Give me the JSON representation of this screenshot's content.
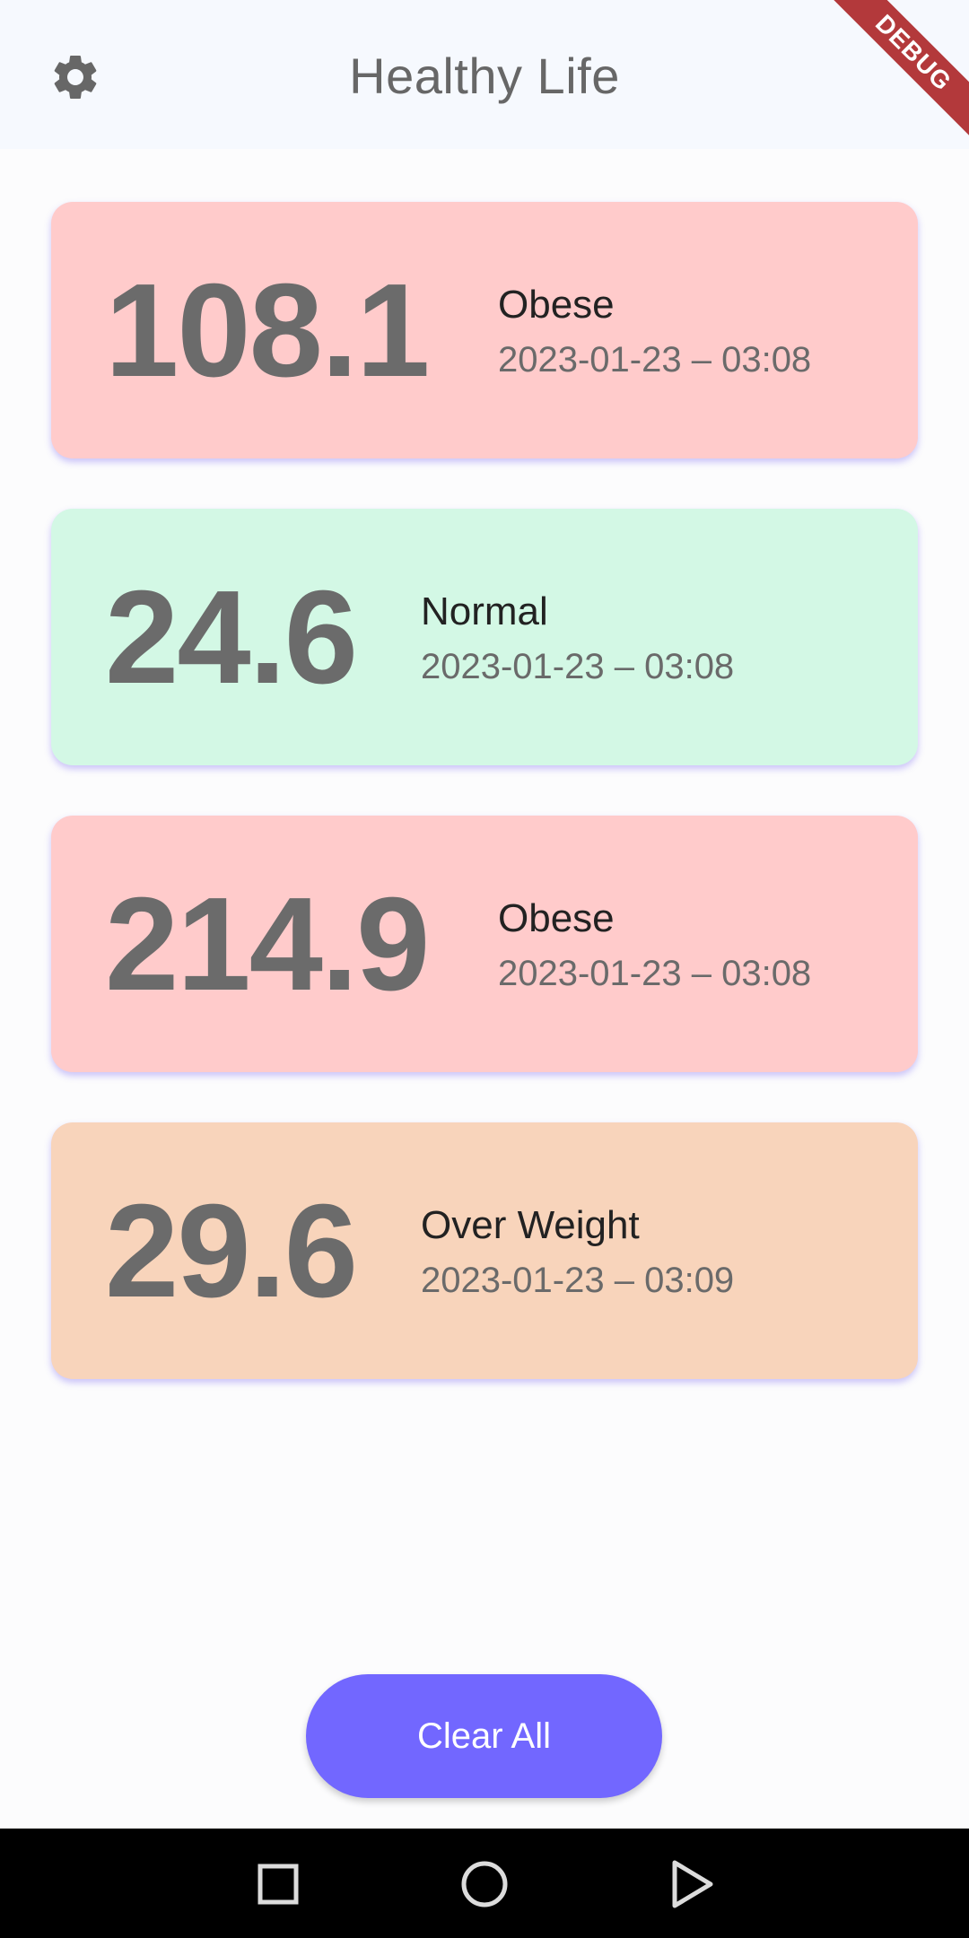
{
  "app": {
    "title": "Healthy Life",
    "debug_banner": "DEBUG"
  },
  "records": [
    {
      "value": "108.1",
      "status": "Obese",
      "timestamp": "2023-01-23 – 03:08",
      "color": "#ffcbcb"
    },
    {
      "value": "24.6",
      "status": "Normal",
      "timestamp": "2023-01-23 – 03:08",
      "color": "#d3f8e5"
    },
    {
      "value": "214.9",
      "status": "Obese",
      "timestamp": "2023-01-23 – 03:08",
      "color": "#ffcbcb"
    },
    {
      "value": "29.6",
      "status": "Over Weight",
      "timestamp": "2023-01-23 – 03:09",
      "color": "#f8d4bb"
    }
  ],
  "actions": {
    "clear_all_label": "Clear All"
  },
  "icons": {
    "settings": "gear-icon",
    "nav_recent": "square-icon",
    "nav_home": "circle-icon",
    "nav_back": "triangle-back-icon"
  },
  "colors": {
    "accent": "#7267ff",
    "debug": "#b3393b"
  }
}
